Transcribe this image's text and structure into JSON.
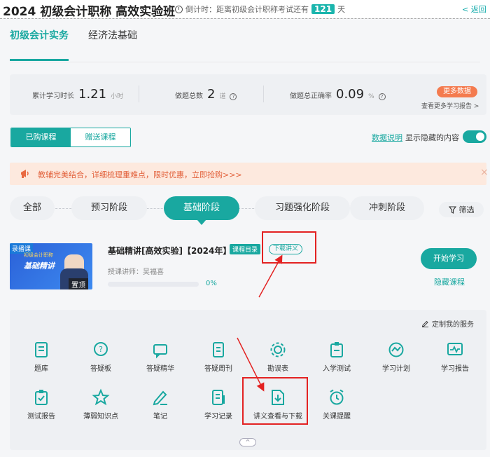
{
  "header": {
    "title": "2024 初级会计职称 高效实验班",
    "countdown_label": "倒计时：距离初级会计职称考试还有",
    "countdown_days": "121",
    "countdown_unit": "天",
    "back_label": "< 返回"
  },
  "subject_tabs": [
    {
      "label": "初级会计实务",
      "active": true
    },
    {
      "label": "经济法基础",
      "active": false
    }
  ],
  "stats": {
    "study_time": {
      "label": "累计学习时长",
      "value": "1.21",
      "unit": "小时"
    },
    "question_count": {
      "label": "做题总数",
      "value": "2",
      "unit": "道"
    },
    "accuracy": {
      "label": "做题总正确率",
      "value": "0.09",
      "unit": "%"
    },
    "more_data_label": "更多数据",
    "report_link": "查看更多学习报告 >"
  },
  "course_segment": {
    "purchased": "已购课程",
    "gift": "赠送课程"
  },
  "data_note_link": "数据说明",
  "show_hidden_label": "显示隐藏的内容",
  "promo": {
    "text": "教辅完美结合，详细梳理重难点，限时优惠，立即抢购>>>",
    "close_icon": "×"
  },
  "stages": [
    {
      "label": "全部",
      "active": false
    },
    {
      "label": "预习阶段",
      "active": false
    },
    {
      "label": "基础阶段",
      "active": true
    },
    {
      "label": "习题强化阶段",
      "active": false
    },
    {
      "label": "冲刺阶段",
      "active": false
    }
  ],
  "filter_label": "筛选",
  "course": {
    "thumb_tag": "录播课",
    "thumb_subtitle": "初级会计职称",
    "thumb_title": "基础精讲",
    "pin_label": "置顶",
    "title": "基础精讲[高效实验]【2024年】",
    "catalog_label": "课程目录",
    "handout_label": "下载讲义",
    "lecturer_label": "授课讲师：",
    "lecturer_name": "吴福喜",
    "progress_text": "0%",
    "progress": 0,
    "start_label": "开始学习",
    "hide_label": "隐藏课程"
  },
  "services": {
    "customize_label": "定制我的服务",
    "items": [
      {
        "label": "题库",
        "icon": "question-bank-icon"
      },
      {
        "label": "答疑板",
        "icon": "qa-board-icon"
      },
      {
        "label": "答疑精华",
        "icon": "qa-essence-icon"
      },
      {
        "label": "答疑周刊",
        "icon": "qa-weekly-icon"
      },
      {
        "label": "勘误表",
        "icon": "errata-icon"
      },
      {
        "label": "入学测试",
        "icon": "entrance-test-icon"
      },
      {
        "label": "学习计划",
        "icon": "study-plan-icon"
      },
      {
        "label": "学习报告",
        "icon": "study-report-icon"
      },
      {
        "label": "测试报告",
        "icon": "test-report-icon"
      },
      {
        "label": "薄弱知识点",
        "icon": "weak-points-icon"
      },
      {
        "label": "笔记",
        "icon": "notes-icon"
      },
      {
        "label": "学习记录",
        "icon": "study-record-icon"
      },
      {
        "label": "讲义查看与下载",
        "icon": "handout-download-icon"
      },
      {
        "label": "关课提醒",
        "icon": "course-reminder-icon"
      }
    ],
    "collapse_icon": "^"
  },
  "colors": {
    "accent": "#19a8a0",
    "promo_text": "#e2603a",
    "more_data": "#f47b4f",
    "annotation_red": "#e32222"
  }
}
